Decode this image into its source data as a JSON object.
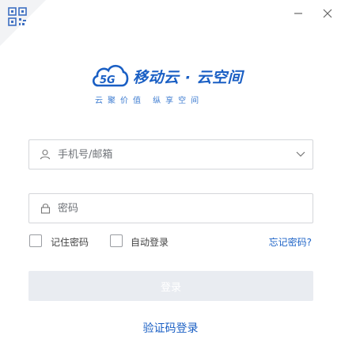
{
  "window": {
    "minimize_icon": "minimize-icon",
    "close_icon": "close-icon"
  },
  "qr_toggle": {
    "icon": "qr-code-icon"
  },
  "brand": {
    "badge": "5G",
    "name": "移动云 · 云空间",
    "slogan": "云聚价值 纵享空间",
    "color": "#1a5fc4"
  },
  "account": {
    "icon": "user-icon",
    "placeholder": "手机号/邮箱",
    "dropdown_icon": "chevron-down-icon"
  },
  "password": {
    "icon": "lock-icon",
    "placeholder": "密码"
  },
  "options": {
    "remember_label": "记住密码",
    "auto_login_label": "自动登录",
    "forgot_label": "忘记密码?"
  },
  "actions": {
    "login_label": "登录",
    "sms_login_label": "验证码登录"
  }
}
